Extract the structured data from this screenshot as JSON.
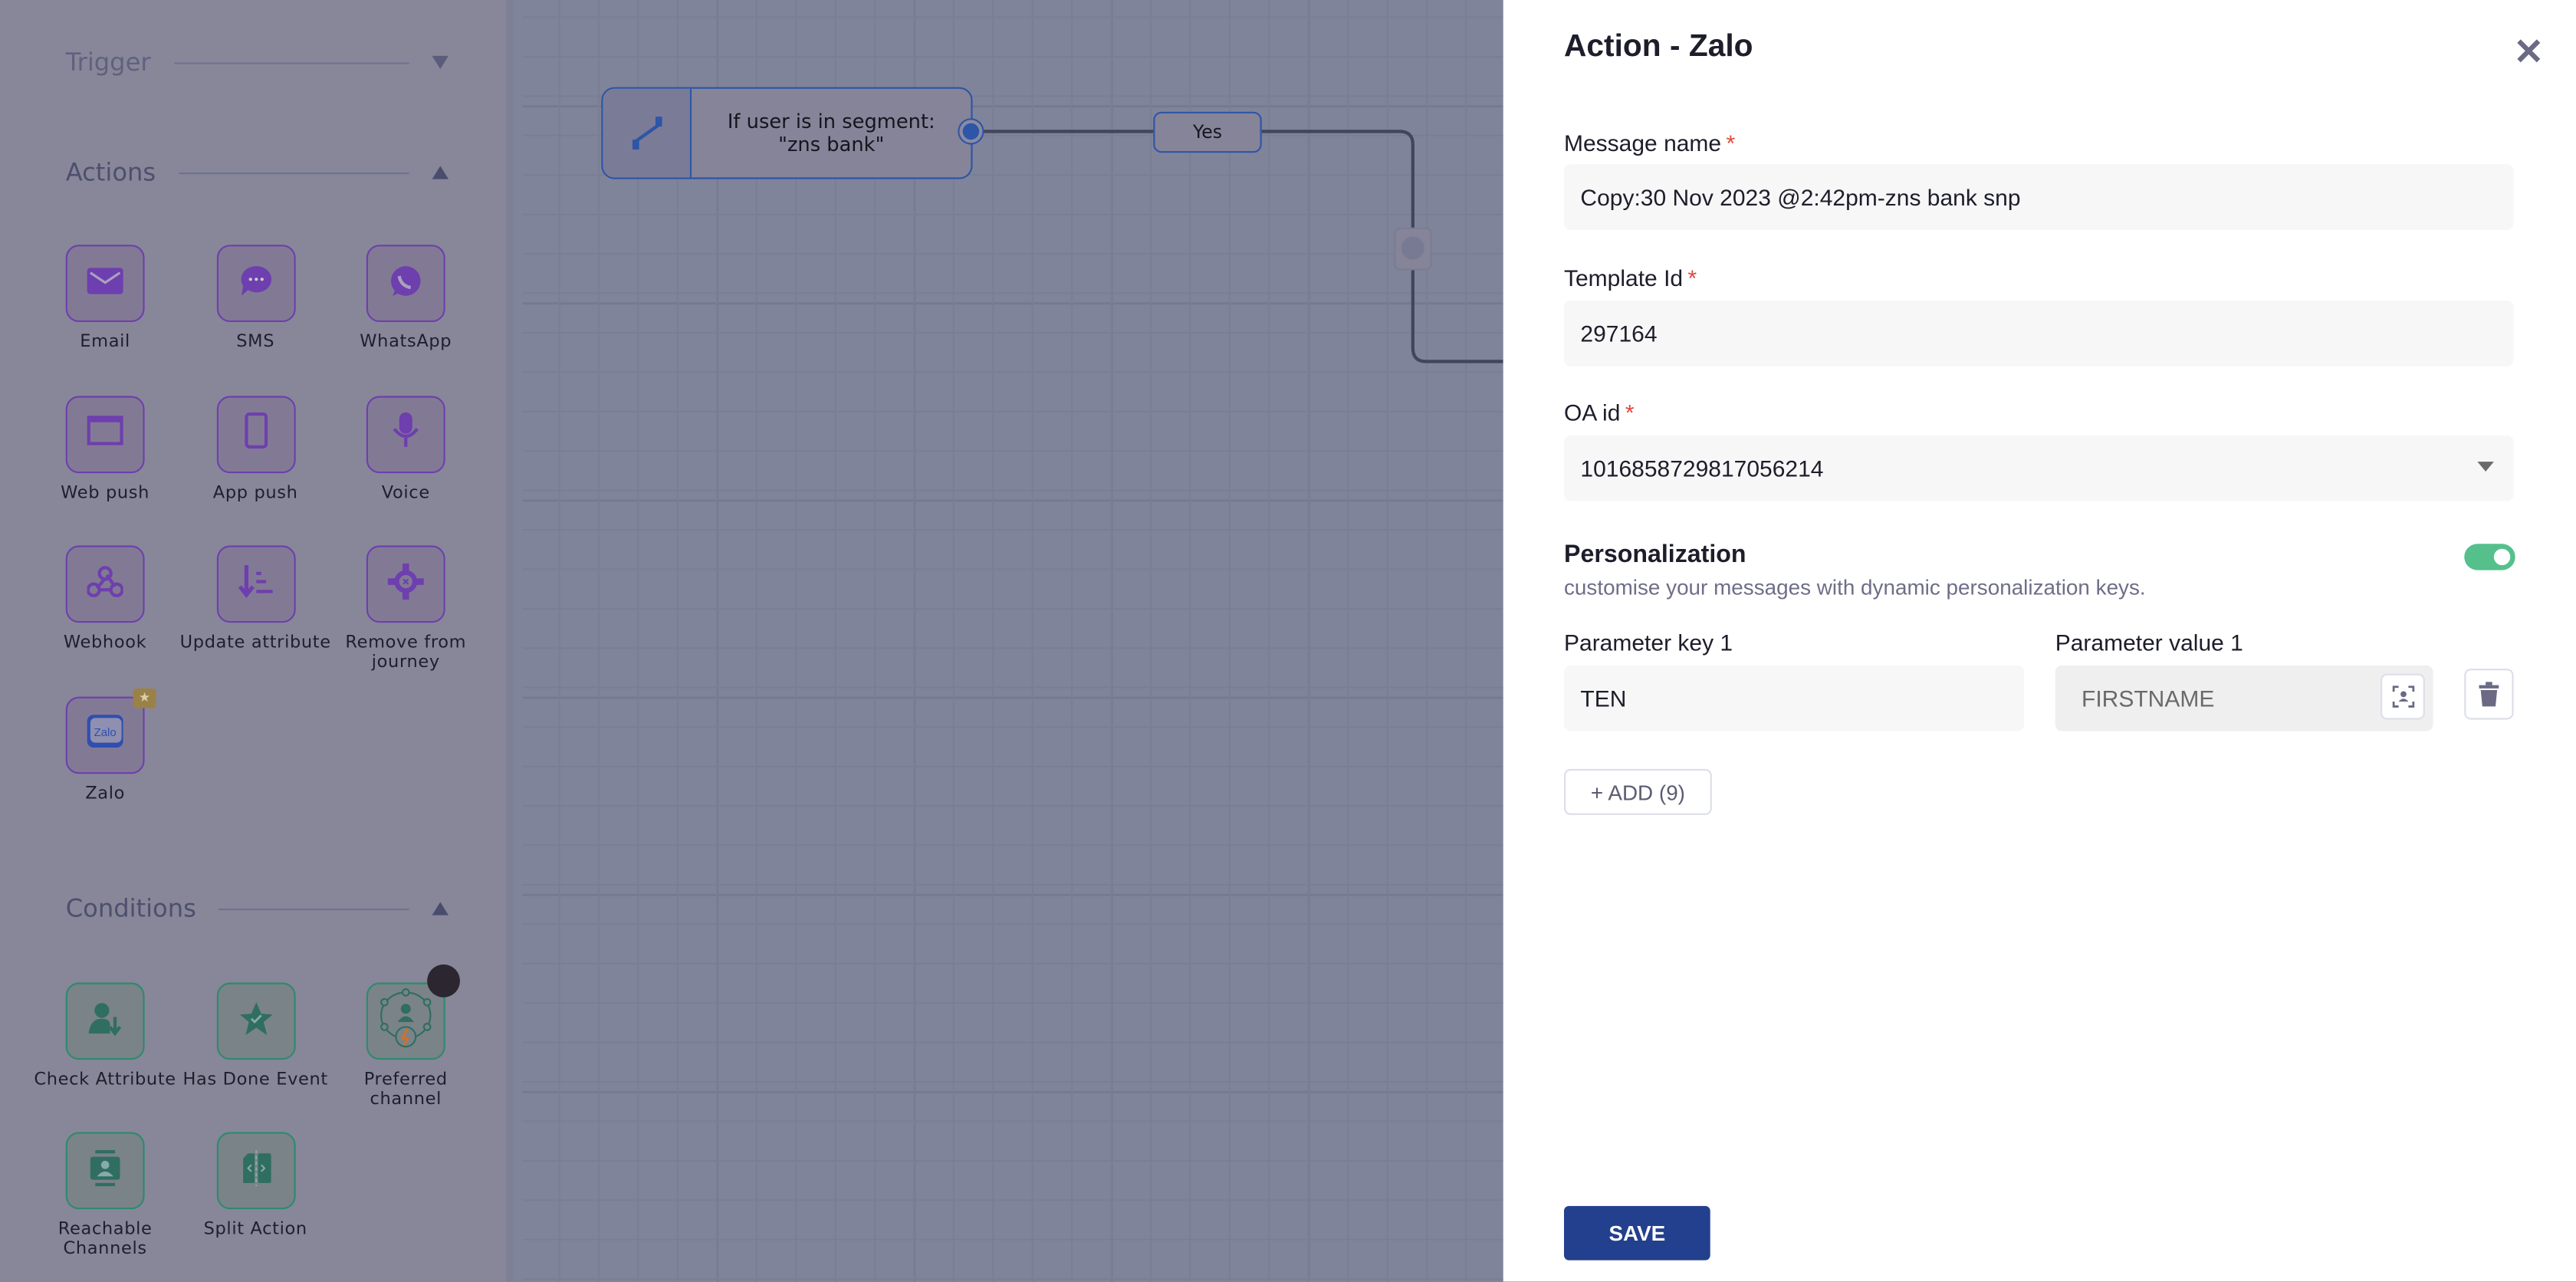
{
  "sidebar": {
    "trigger": {
      "title": "Trigger",
      "state": "collapsed"
    },
    "actions": {
      "title": "Actions",
      "state": "expanded",
      "items": [
        {
          "label": "Email",
          "icon": "envelope-icon"
        },
        {
          "label": "SMS",
          "icon": "chat-bubble-icon"
        },
        {
          "label": "WhatsApp",
          "icon": "whatsapp-icon"
        },
        {
          "label": "Web push",
          "icon": "browser-window-icon"
        },
        {
          "label": "App push",
          "icon": "mobile-icon"
        },
        {
          "label": "Voice",
          "icon": "microphone-icon"
        },
        {
          "label": "Webhook",
          "icon": "webhook-icon"
        },
        {
          "label": "Update attribute",
          "icon": "sort-down-icon"
        },
        {
          "label": "Remove from journey",
          "icon": "gear-x-icon"
        },
        {
          "label": "Zalo",
          "icon": "zalo-logo",
          "logo_text": "Zalo",
          "badge": "premium-star-icon"
        }
      ]
    },
    "conditions": {
      "title": "Conditions",
      "state": "expanded",
      "items": [
        {
          "label": "Check Attribute",
          "icon": "user-arrow-icon"
        },
        {
          "label": "Has Done Event",
          "icon": "star-check-icon"
        },
        {
          "label": "Preferred channel",
          "icon": "user-network-icon"
        },
        {
          "label": "Reachable Channels",
          "icon": "contact-card-icon"
        },
        {
          "label": "Split Action",
          "icon": "split-icon"
        }
      ]
    }
  },
  "canvas": {
    "node": {
      "line1": "If user is in segment:",
      "line2": "\"zns bank\""
    },
    "branch_label": "Yes"
  },
  "panel": {
    "title": "Action - Zalo",
    "message_name": {
      "label": "Message name",
      "required": "*",
      "value": "Copy:30 Nov 2023 @2:42pm-zns bank snp"
    },
    "template_id": {
      "label": "Template Id",
      "required": "*",
      "value": "297164"
    },
    "oa_id": {
      "label": "OA id",
      "required": "*",
      "value": "1016858729817056214"
    },
    "personalization": {
      "title": "Personalization",
      "subtitle": "customise your messages with dynamic personalization keys.",
      "enabled": true,
      "params": [
        {
          "key_label": "Parameter key 1",
          "key": "TEN",
          "value_label": "Parameter value 1",
          "value": "FIRSTNAME"
        }
      ],
      "add_label": "+ ADD (9)"
    },
    "save_label": "SAVE"
  },
  "colors": {
    "accent": "#23408e",
    "toggle_on": "#55c08c",
    "required": "#e0483f",
    "actions_border": "#6e3fae",
    "conditions_border": "#2e8a6e"
  }
}
